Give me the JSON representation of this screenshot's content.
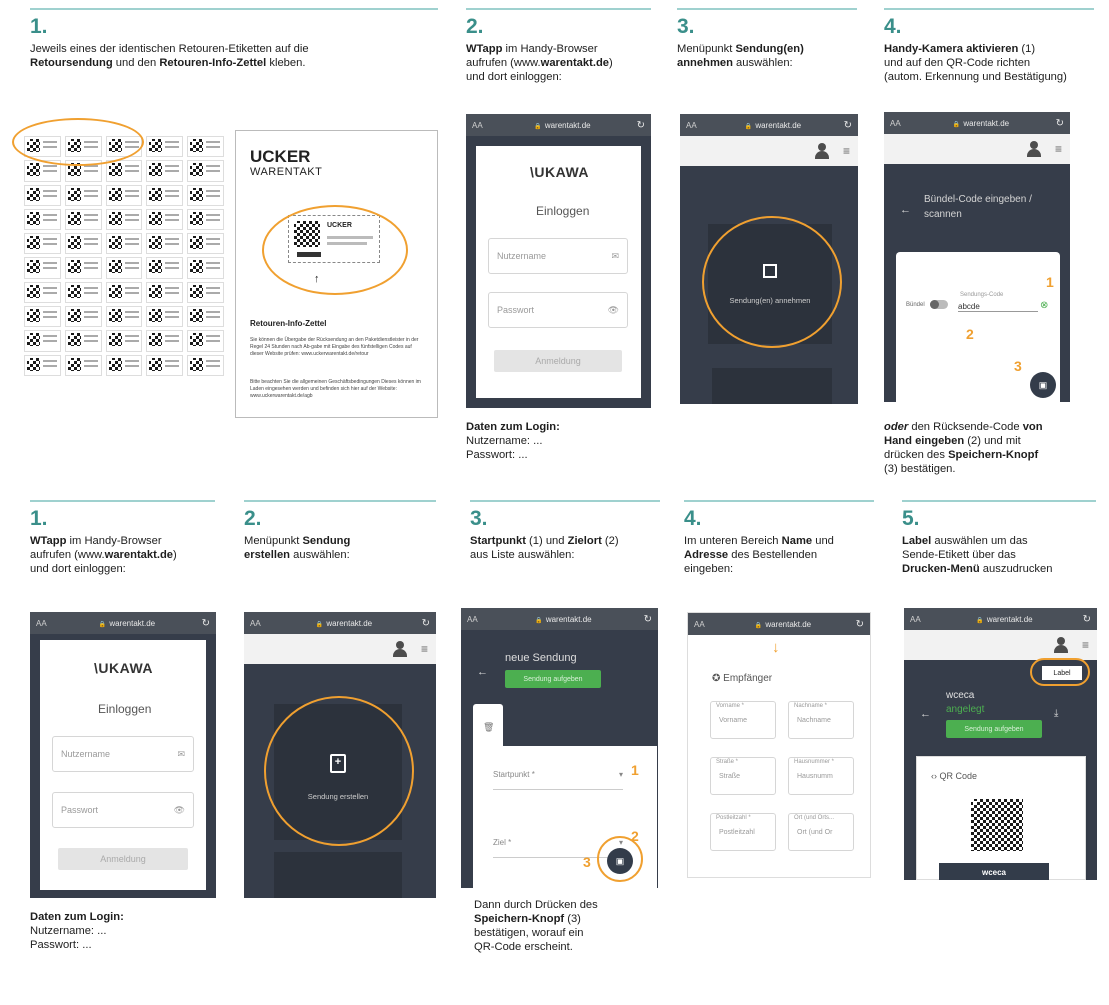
{
  "top": {
    "s1": {
      "num": "1.",
      "desc_a": "Jeweils eines der identischen Retouren-Etiketten auf die",
      "desc_b": "Retoursendung",
      "desc_c": " und den ",
      "desc_d": "Retouren-Info-Zettel",
      "desc_e": " kleben."
    },
    "s2": {
      "num": "2.",
      "l1a": "WTapp",
      "l1b": " im Handy-Browser",
      "l2": "aufrufen (www.",
      "l2b": "warentakt.de",
      "l2c": ")",
      "l3": "und dort einloggen:"
    },
    "s3": {
      "num": "3.",
      "l1": "Menüpunkt ",
      "l1b": "Sendung(en)",
      "l2b": "annehmen",
      "l2": " auswählen:"
    },
    "s4": {
      "num": "4.",
      "l1b": "Handy-Kamera aktivieren",
      "l1": " (1)",
      "l2": "und auf den QR-Code richten",
      "l3": "(autom. Erkennung und Bestätigung)"
    },
    "info": {
      "brand1": "UCKER",
      "brand2": "WARENTAKT",
      "card_t": "UCKER",
      "title": "Retouren-Info-Zettel",
      "p1": "Sie können die Übergabe der Rücksendung an den Paketdienstleister in der Regel 24 Stunden nach Ab-gabe mit Eingabe des fünfstelligen Codes auf dieser Website prüfen: www.uckerwarentakt.de/retour",
      "p2": "Bitte beachten Sie die allgemeinen Geschäftsbedingungen Dieses können im Laden eingesehen werden und befinden sich hier auf der Website: www.uckerwarentakt.de/agb"
    },
    "login": {
      "url": "warentakt.de",
      "aa": "AA",
      "logo": "\\UKAWA",
      "title": "Einloggen",
      "user": "Nutzername",
      "pass": "Passwort",
      "btn": "Anmeldung"
    },
    "login_info": {
      "head": "Daten zum Login:",
      "user": "Nutzername: ...",
      "pass": "Passwort: ..."
    },
    "accept": {
      "label": "Sendung(en) annehmen"
    },
    "scan": {
      "title": "Bündel-Code eingeben / scannen",
      "bundle": "Bündel",
      "code_lbl": "Sendungs-Code",
      "code_val": "abcde",
      "n1": "1",
      "n2": "2",
      "n3": "3"
    },
    "s4b": {
      "l1a": "oder",
      "l1": " den Rücksende-Code ",
      "l1b": "von",
      "l2b": "Hand eingeben",
      "l2": " (2) und mit",
      "l3": "drücken des ",
      "l3b": "Speichern-Knopf",
      "l4": "(3) bestätigen."
    }
  },
  "bottom": {
    "s1": {
      "num": "1.",
      "l1a": "WTapp",
      "l1b": " im Handy-Browser",
      "l2": "aufrufen (www.",
      "l2b": "warentakt.de",
      "l2c": ")",
      "l3": "und dort einloggen:"
    },
    "s2": {
      "num": "2.",
      "l1": "Menüpunkt ",
      "l1b": "Sendung",
      "l2b": "erstellen",
      "l2": " auswählen:"
    },
    "s3": {
      "num": "3.",
      "l1b": "Startpunkt",
      "l1": " (1) und ",
      "l1c": "Zielort",
      "l1d": " (2)",
      "l2": "aus Liste auswählen:"
    },
    "s4": {
      "num": "4.",
      "l1": "Im unteren Bereich ",
      "l1b": "Name",
      "l1c": " und",
      "l2b": "Adresse",
      "l2": " des Bestellenden",
      "l3": "eingeben:"
    },
    "s5": {
      "num": "5.",
      "l1b": "Label",
      "l1": " auswählen  um das",
      "l2": "Sende-Etikett über das",
      "l3b": "Drucken-Menü",
      "l3": " auszudrucken"
    },
    "create": {
      "label": "Sendung erstellen"
    },
    "new": {
      "title": "neue Sendung",
      "btn": "Sendung aufgeben",
      "start": "Startpunkt *",
      "ziel": "Ziel *",
      "n1": "1",
      "n2": "2",
      "n3": "3"
    },
    "s3b": {
      "l1": "Dann durch Drücken des",
      "l2b": "Speichern-Knopf",
      "l2": " (3)",
      "l3": "bestätigen, worauf ein",
      "l4": "QR-Code erscheint."
    },
    "recv": {
      "title": "Empfänger",
      "vn": "Vorname *",
      "vn_p": "Vorname",
      "nn": "Nachname *",
      "nn_p": "Nachname",
      "st": "Straße *",
      "st_p": "Straße",
      "hn": "Hausnummer *",
      "hn_p": "Hausnumm",
      "pl": "Postleitzahl *",
      "pl_p": "Postleitzahl",
      "ort": "Ort (und Orts...",
      "ort_p": "Ort (und Or"
    },
    "label": {
      "label_btn": "Label",
      "name": "wceca",
      "status": "angelegt",
      "btn": "Sendung aufgeben",
      "qr_title": "QR Code",
      "footer": "wceca"
    }
  }
}
